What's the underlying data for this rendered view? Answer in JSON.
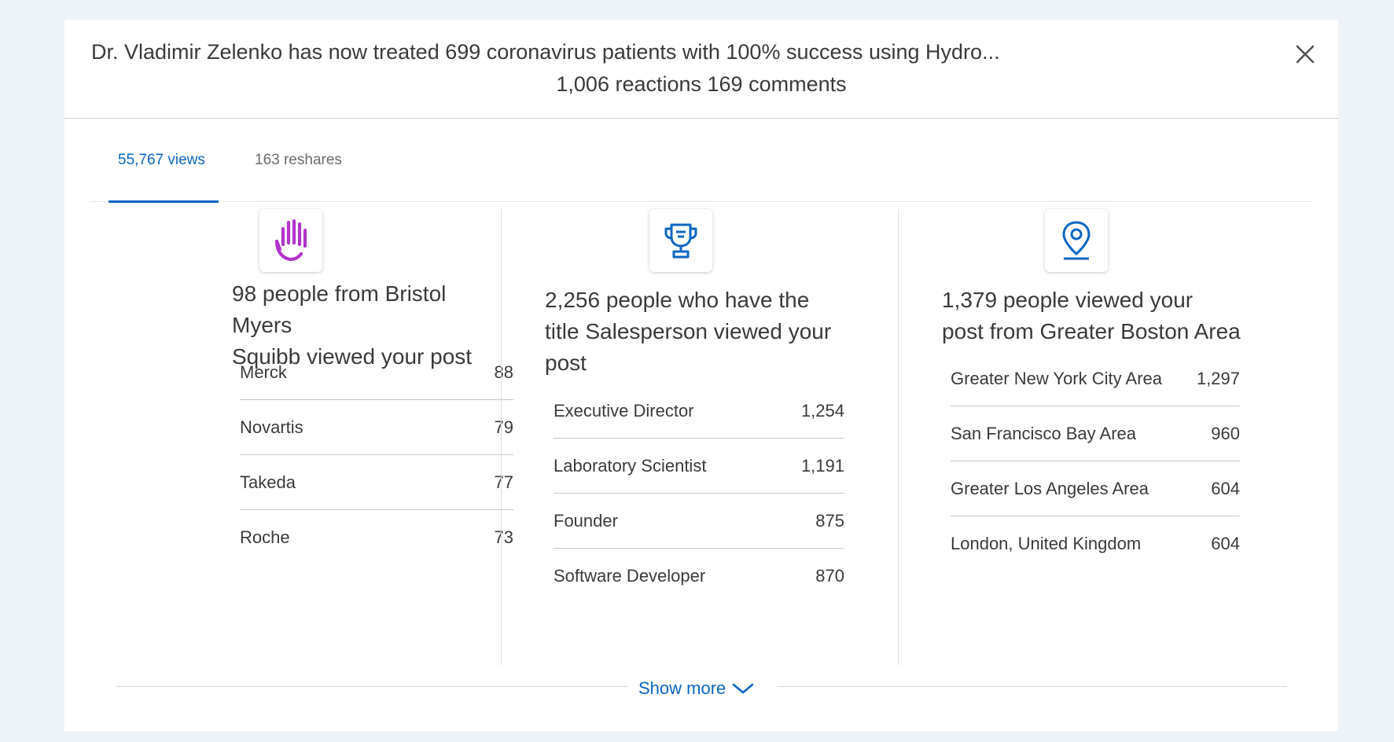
{
  "post": {
    "title": "Dr. Vladimir Zelenko has now treated 699 coronavirus patients with 100% success using Hydro...",
    "stats": "1,006 reactions 169 comments"
  },
  "tabs": [
    {
      "label": "55,767 views",
      "active": true
    },
    {
      "label": "163 reshares",
      "active": false
    }
  ],
  "columns": [
    {
      "icon": "raised-hand-icon",
      "headline_line1": "98 people from Bristol Myers",
      "headline_line2": "Squibb viewed your post",
      "items": [
        {
          "label": "Merck",
          "value": "88"
        },
        {
          "label": "Novartis",
          "value": "79"
        },
        {
          "label": "Takeda",
          "value": "77"
        },
        {
          "label": "Roche",
          "value": "73"
        }
      ]
    },
    {
      "icon": "trophy-icon",
      "headline_line1": "2,256 people who have the",
      "headline_line2": "title Salesperson viewed your",
      "headline_line3": "post",
      "items": [
        {
          "label": "Executive Director",
          "value": "1,254"
        },
        {
          "label": "Laboratory Scientist",
          "value": "1,191"
        },
        {
          "label": "Founder",
          "value": "875"
        },
        {
          "label": "Software Developer",
          "value": "870"
        }
      ]
    },
    {
      "icon": "location-pin-icon",
      "headline_line1": "1,379 people viewed your",
      "headline_line2": "post from Greater Boston Area",
      "items": [
        {
          "label": "Greater New York City Area",
          "value": "1,297"
        },
        {
          "label": "San Francisco Bay Area",
          "value": "960"
        },
        {
          "label": "Greater Los Angeles Area",
          "value": "604"
        },
        {
          "label": "London, United Kingdom",
          "value": "604"
        }
      ]
    }
  ],
  "footer": {
    "show_more_label": "Show more"
  },
  "colors": {
    "accent": "#0a66c2",
    "hand_icon": "#b035c9",
    "background": "#eef3f8"
  }
}
